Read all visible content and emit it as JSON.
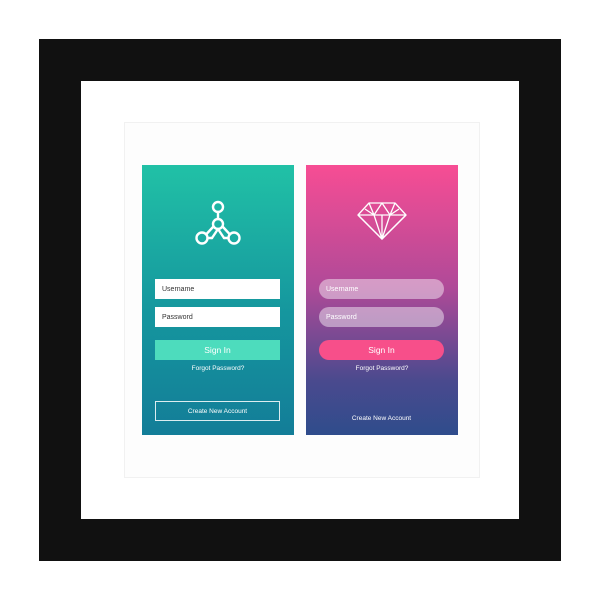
{
  "colors": {
    "teal_top": "#21c1a6",
    "teal_bottom": "#137d98",
    "teal_button": "#4ddcbd",
    "pink_top": "#f74d94",
    "pink_bottom": "#2f4c8c",
    "pink_button": "#f74f8a"
  },
  "screens": [
    {
      "theme": "teal",
      "logo_icon": "molecule-icon",
      "username_placeholder": "Username",
      "password_placeholder": "Password",
      "signin_label": "Sign In",
      "forgot_label": "Forgot Password?",
      "create_label": "Create New Account"
    },
    {
      "theme": "pink",
      "logo_icon": "diamond-icon",
      "username_placeholder": "Username",
      "password_placeholder": "Password",
      "signin_label": "Sign In",
      "forgot_label": "Forgot Password?",
      "create_label": "Create New Account"
    }
  ]
}
